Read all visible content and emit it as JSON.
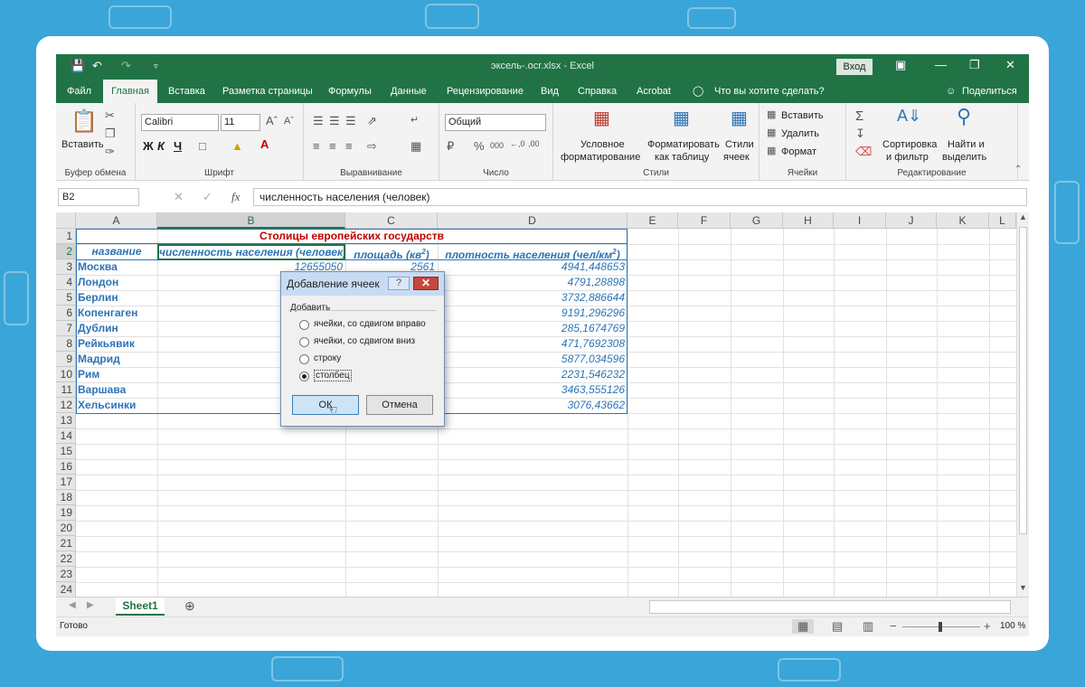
{
  "titlebar": {
    "title": "эксель-.ocr.xlsx  -  Excel",
    "signin": "Вход"
  },
  "tabs": [
    {
      "label": "Файл"
    },
    {
      "label": "Главная"
    },
    {
      "label": "Вставка"
    },
    {
      "label": "Разметка страницы"
    },
    {
      "label": "Формулы"
    },
    {
      "label": "Данные"
    },
    {
      "label": "Рецензирование"
    },
    {
      "label": "Вид"
    },
    {
      "label": "Справка"
    },
    {
      "label": "Acrobat"
    },
    {
      "label": "Что вы хотите сделать?"
    },
    {
      "label": "Поделиться"
    }
  ],
  "ribbon": {
    "paste": "Вставить",
    "clipboard": "Буфер обмена",
    "font_name": "Calibri",
    "font_size": "11",
    "bold": "Ж",
    "italic": "К",
    "underline": "Ч",
    "font_group": "Шрифт",
    "align_group": "Выравнивание",
    "number_format": "Общий",
    "number_group": "Число",
    "cond_format": "Условное",
    "cond_format2": "форматирование",
    "format_table": "Форматировать",
    "format_table2": "как таблицу",
    "cell_styles": "Стили",
    "cell_styles2": "ячеек",
    "styles_group": "Стили",
    "insert": "Вставить",
    "delete": "Удалить",
    "format": "Формат",
    "cells_group": "Ячейки",
    "sort": "Сортировка",
    "sort2": "и фильтр",
    "find": "Найти и",
    "find2": "выделить",
    "editing_group": "Редактирование"
  },
  "formula_bar": {
    "name_box": "B2",
    "fx": "fx",
    "content": "численность населения (человек)"
  },
  "columns": [
    "A",
    "B",
    "C",
    "D",
    "E",
    "F",
    "G",
    "H",
    "I",
    "J",
    "K",
    "L"
  ],
  "rows": [
    "1",
    "2",
    "3",
    "4",
    "5",
    "6",
    "7",
    "8",
    "9",
    "10",
    "11",
    "12",
    "13",
    "14",
    "15",
    "16",
    "17",
    "18",
    "19",
    "20",
    "21",
    "22",
    "23",
    "24"
  ],
  "table": {
    "title": "Столицы европейских государств",
    "headers": {
      "a": "название",
      "b": "численность населения (человек)",
      "c": "площадь (кв",
      "c_sup": "2",
      "c_end": ")",
      "d": "плотность населения (чел/км",
      "d_sup": "2",
      "d_end": ")"
    },
    "data": [
      {
        "city": "Москва",
        "pop": "12655050",
        "area": "2561",
        "density": "4941,448653"
      },
      {
        "city": "Лондон",
        "density": "4791,28898"
      },
      {
        "city": "Берлин",
        "density": "3732,886644"
      },
      {
        "city": "Копенгаген",
        "density": "9191,296296"
      },
      {
        "city": "Дублин",
        "density": "285,1674769"
      },
      {
        "city": "Рейкьявик",
        "density": "471,7692308"
      },
      {
        "city": "Мадрид",
        "density": "5877,034596"
      },
      {
        "city": "Рим",
        "density": "2231,546232"
      },
      {
        "city": "Варшава",
        "density": "3463,555126"
      },
      {
        "city": "Хельсинки",
        "density": "3076,43662"
      }
    ]
  },
  "dialog": {
    "title": "Добавление ячеек",
    "help": "?",
    "group_label": "Добавить",
    "options": [
      {
        "label": "ячейки, со сдвигом вправо",
        "selected": false
      },
      {
        "label": "ячейки, со сдвигом вниз",
        "selected": false
      },
      {
        "label": "строку",
        "selected": false
      },
      {
        "label": "столбец",
        "selected": true
      }
    ],
    "ok": "ОК",
    "cancel": "Отмена"
  },
  "sheet_tab": "Sheet1",
  "status": {
    "ready": "Готово",
    "zoom": "100 %"
  }
}
